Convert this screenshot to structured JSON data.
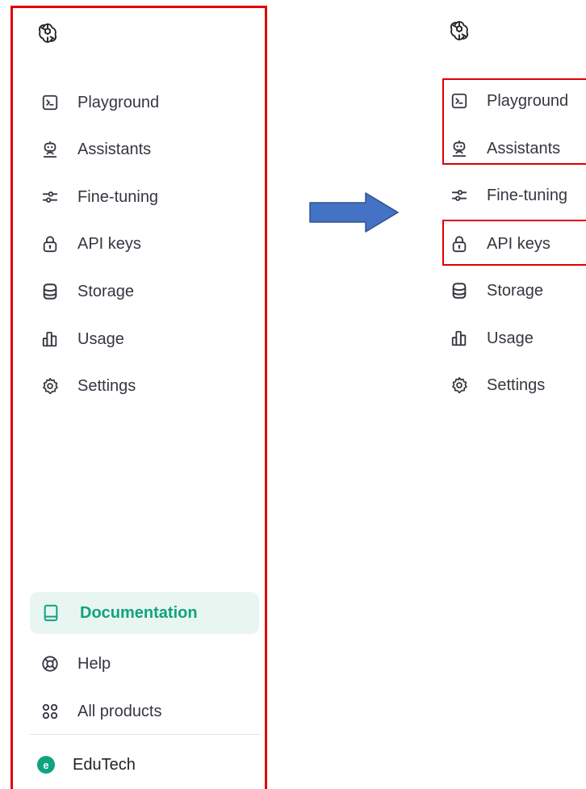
{
  "left_sidebar": {
    "nav": [
      {
        "label": "Playground",
        "icon": "terminal-icon"
      },
      {
        "label": "Assistants",
        "icon": "robot-icon"
      },
      {
        "label": "Fine-tuning",
        "icon": "sliders-icon"
      },
      {
        "label": "API keys",
        "icon": "lock-icon"
      },
      {
        "label": "Storage",
        "icon": "database-icon"
      },
      {
        "label": "Usage",
        "icon": "bar-chart-icon"
      },
      {
        "label": "Settings",
        "icon": "gear-icon"
      }
    ],
    "footer": [
      {
        "label": "Documentation",
        "icon": "book-icon",
        "active": true
      },
      {
        "label": "Help",
        "icon": "lifebuoy-icon"
      },
      {
        "label": "All products",
        "icon": "grid-dots-icon"
      }
    ],
    "organization": {
      "avatar_letter": "e",
      "name": "EduTech"
    }
  },
  "right_sidebar": {
    "nav": [
      {
        "label": "Playground",
        "icon": "terminal-icon",
        "highlighted": true
      },
      {
        "label": "Assistants",
        "icon": "robot-icon",
        "highlighted": true
      },
      {
        "label": "Fine-tuning",
        "icon": "sliders-icon"
      },
      {
        "label": "API keys",
        "icon": "lock-icon",
        "highlighted": true
      },
      {
        "label": "Storage",
        "icon": "database-icon"
      },
      {
        "label": "Usage",
        "icon": "bar-chart-icon"
      },
      {
        "label": "Settings",
        "icon": "gear-icon"
      }
    ]
  },
  "colors": {
    "accent": "#10a37f",
    "active_bg": "#e9f5f1",
    "highlight_border": "#e00000",
    "arrow_fill": "#4472c4",
    "text": "#353740"
  }
}
